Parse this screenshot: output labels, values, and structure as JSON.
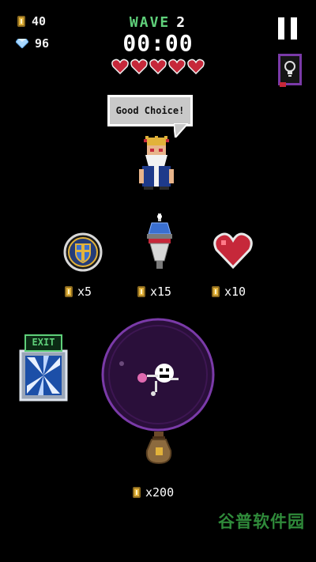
{
  "hud": {
    "coins": "40",
    "gems": "96",
    "wave_label": "WAVE",
    "wave_number": "2",
    "timer": "00:00",
    "hearts_filled": 5,
    "hearts_total": 5
  },
  "merchant": {
    "speech": "Good Choice!"
  },
  "shop": {
    "items": [
      {
        "icon": "shield-badge-icon",
        "price": "x5"
      },
      {
        "icon": "tower-turret-icon",
        "price": "x15"
      },
      {
        "icon": "heart-icon",
        "price": "x10"
      }
    ],
    "bag_price": "x200"
  },
  "exit": {
    "label": "EXIT"
  },
  "watermark": {
    "text": "谷普软件园"
  },
  "colors": {
    "background": "#000000",
    "wave_green": "#5fd07a",
    "heart_red": "#c6283a",
    "portal_purple": "#7a3aa8",
    "coin_gold": "#e2b23a"
  }
}
